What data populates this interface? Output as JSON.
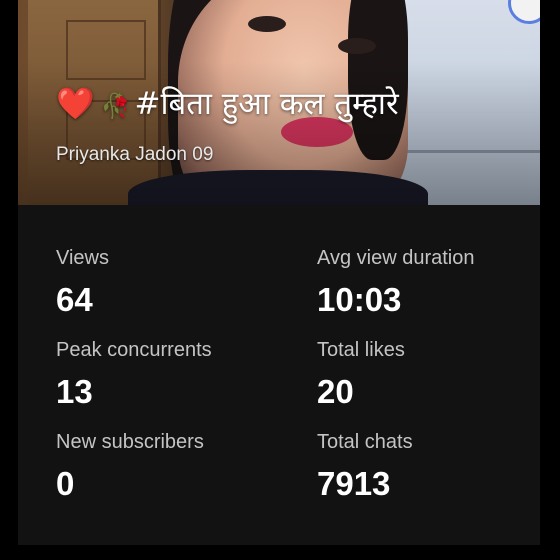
{
  "video": {
    "title": "#बिता हुआ कल तुम्हारे",
    "title_emojis": [
      "❤️",
      "🥀"
    ],
    "channel": "Priyanka Jadon 09"
  },
  "stats": {
    "views": {
      "label": "Views",
      "value": "64"
    },
    "avg_view_duration": {
      "label": "Avg view duration",
      "value": "10:03"
    },
    "peak_concurrents": {
      "label": "Peak concurrents",
      "value": "13"
    },
    "total_likes": {
      "label": "Total likes",
      "value": "20"
    },
    "new_subscribers": {
      "label": "New subscribers",
      "value": "0"
    },
    "total_chats": {
      "label": "Total chats",
      "value": "7913"
    }
  },
  "colors": {
    "card_bg": "#121212",
    "label": "#c4c4c4",
    "value": "#ffffff"
  }
}
